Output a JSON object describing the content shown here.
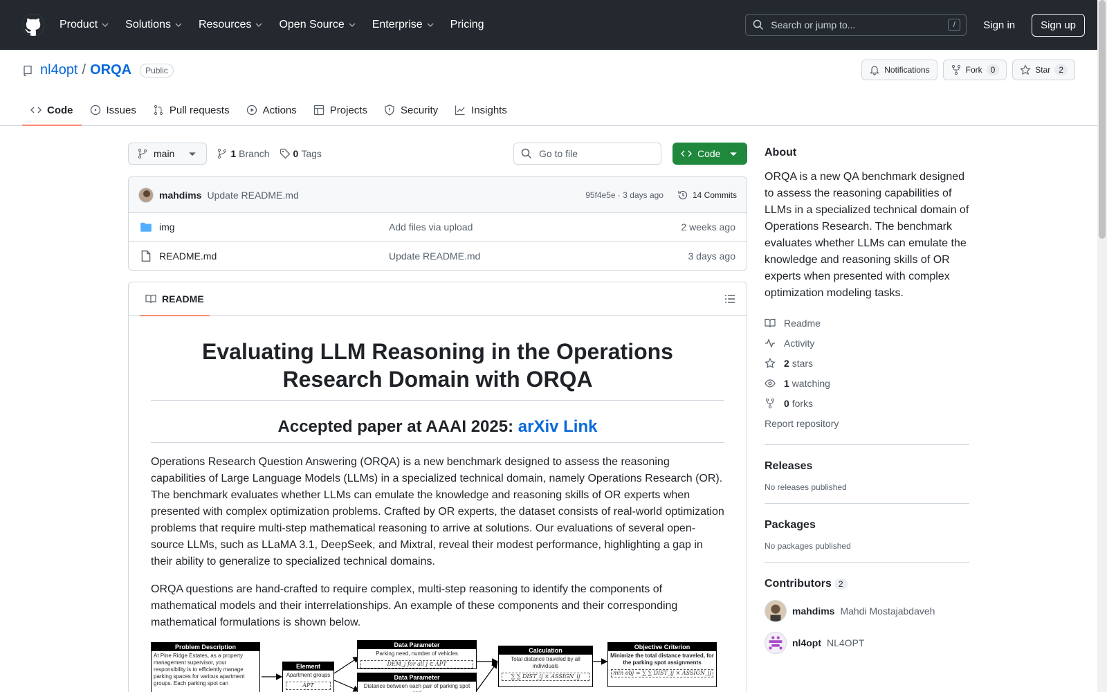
{
  "header": {
    "nav": [
      {
        "label": "Product",
        "dropdown": true
      },
      {
        "label": "Solutions",
        "dropdown": true
      },
      {
        "label": "Resources",
        "dropdown": true
      },
      {
        "label": "Open Source",
        "dropdown": true
      },
      {
        "label": "Enterprise",
        "dropdown": true
      },
      {
        "label": "Pricing",
        "dropdown": false
      }
    ],
    "search_placeholder": "Search or jump to...",
    "search_key": "/",
    "sign_in": "Sign in",
    "sign_up": "Sign up"
  },
  "repo": {
    "owner": "nl4opt",
    "separator": "/",
    "name": "ORQA",
    "visibility": "Public",
    "notifications_label": "Notifications",
    "fork_label": "Fork",
    "fork_count": "0",
    "star_label": "Star",
    "star_count": "2",
    "tabs": [
      {
        "label": "Code",
        "icon": "code-icon",
        "active": true
      },
      {
        "label": "Issues",
        "icon": "issue-icon",
        "active": false
      },
      {
        "label": "Pull requests",
        "icon": "pull-request-icon",
        "active": false
      },
      {
        "label": "Actions",
        "icon": "play-icon",
        "active": false
      },
      {
        "label": "Projects",
        "icon": "table-icon",
        "active": false
      },
      {
        "label": "Security",
        "icon": "shield-icon",
        "active": false
      },
      {
        "label": "Insights",
        "icon": "graph-icon",
        "active": false
      }
    ]
  },
  "toolbar": {
    "branch": "main",
    "branch_count": "1",
    "branch_label": "Branch",
    "tag_count": "0",
    "tag_label": "Tags",
    "goto_placeholder": "Go to file",
    "code_label": "Code"
  },
  "commit": {
    "author": "mahdims",
    "message": "Update README.md",
    "hash_time": "95f4e5e · 3 days ago",
    "commits_label": "14 Commits"
  },
  "files": [
    {
      "name": "img",
      "type": "folder",
      "message": "Add files via upload",
      "date": "2 weeks ago"
    },
    {
      "name": "README.md",
      "type": "file",
      "message": "Update README.md",
      "date": "3 days ago"
    }
  ],
  "readme": {
    "tab_label": "README",
    "title": "Evaluating LLM Reasoning in the Operations Research Domain with ORQA",
    "subtitle_prefix": "Accepted paper at AAAI 2025: ",
    "subtitle_link": "arXiv Link",
    "para1": "Operations Research Question Answering (ORQA) is a new benchmark designed to assess the reasoning capabilities of Large Language Models (LLMs) in a specialized technical domain, namely Operations Research (OR). The benchmark evaluates whether LLMs can emulate the knowledge and reasoning skills of OR experts when presented with complex optimization problems. Crafted by OR experts, the dataset consists of real-world optimization problems that require multi-step mathematical reasoning to arrive at solutions. Our evaluations of several open-source LLMs, such as LLaMA 3.1, DeepSeek, and Mixtral, reveal their modest performance, highlighting a gap in their ability to generalize to specialized technical domains.",
    "para2": "ORQA questions are hand-crafted to require complex, multi-step reasoning to identify the components of mathematical models and their interrelationships. An example of these components and their corresponding mathematical formulations is shown below.",
    "figure": {
      "problem_title": "Problem Description",
      "problem_text": "At Pine Ridge Estates, as a property management supervisor, your responsibility is to efficiently manage parking spaces for various apartment groups. Each parking spot can",
      "element_title": "Element",
      "element_value": "Apartment groups",
      "element_value2": "APT",
      "dp1_title": "Data Parameter",
      "dp1_value": "Parking need, number of vehicles",
      "dp1_math": "DEM_j for all j ∈ APT",
      "dp2_title": "Data Parameter",
      "dp2_value": "Distance between each pair of parking spot and",
      "calc_title": "Calculation",
      "calc_value": "Total distance traveled by all individuals",
      "calc_math": "∑ ∑ DIST_ij × ASSIGN_ij",
      "obj_title": "Objective Criterion",
      "obj_value": "Minimize the total distance traveled, for the parking spot assignments",
      "obj_math": "min obj = ∑ ∑ DIST_ij × ASSIGN_ij"
    }
  },
  "sidebar": {
    "about_title": "About",
    "about_text": "ORQA is a new QA benchmark designed to assess the reasoning capabilities of LLMs in a specialized technical domain of Operations Research. The benchmark evaluates whether LLMs can emulate the knowledge and reasoning skills of OR experts when presented with complex optimization modeling tasks.",
    "links": [
      {
        "icon": "book-icon",
        "bold": "",
        "label": "Readme"
      },
      {
        "icon": "pulse-icon",
        "bold": "",
        "label": "Activity"
      },
      {
        "icon": "star-icon",
        "bold": "2",
        "label": "stars"
      },
      {
        "icon": "eye-icon",
        "bold": "1",
        "label": "watching"
      },
      {
        "icon": "fork-icon",
        "bold": "0",
        "label": "forks"
      }
    ],
    "report": "Report repository",
    "releases_title": "Releases",
    "releases_text": "No releases published",
    "packages_title": "Packages",
    "packages_text": "No packages published",
    "contributors_title": "Contributors",
    "contributors_count": "2",
    "contributors": [
      {
        "login": "mahdims",
        "name": "Mahdi Mostajabdaveh"
      },
      {
        "login": "nl4opt",
        "name": "NL4OPT"
      }
    ]
  }
}
